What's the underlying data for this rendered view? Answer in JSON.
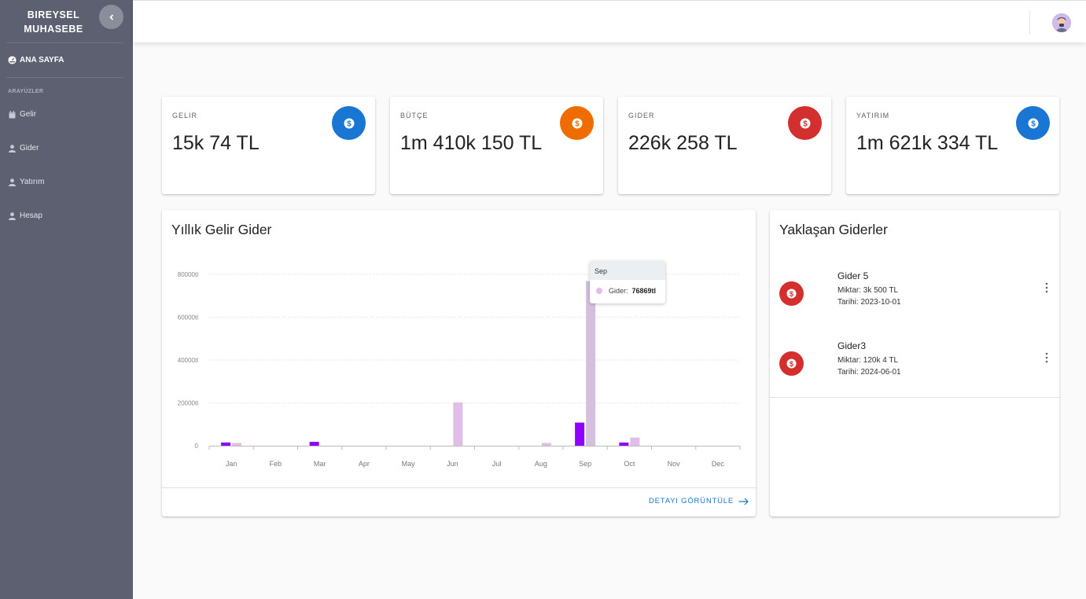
{
  "app": {
    "brand_line1": "BIREYSEL",
    "brand_line2": "MUHASEBE"
  },
  "sidebar": {
    "home_label": "ANA SAYFA",
    "section_title": "ARAYÜZLER",
    "items": [
      {
        "label": "Gelir",
        "icon": "calendar-icon"
      },
      {
        "label": "Gider",
        "icon": "person-icon"
      },
      {
        "label": "Yatırım",
        "icon": "person-icon"
      },
      {
        "label": "Hesap",
        "icon": "person-icon"
      }
    ]
  },
  "stats": [
    {
      "label": "GELIR",
      "value": "15k 74 TL",
      "color": "#1976d2",
      "icon": "dollar-icon"
    },
    {
      "label": "BÜTÇE",
      "value": "1m 410k 150 TL",
      "color": "#ef6c00",
      "icon": "dollar-icon"
    },
    {
      "label": "GIDER",
      "value": "226k 258 TL",
      "color": "#d32f2f",
      "icon": "dollar-icon"
    },
    {
      "label": "YATIRIM",
      "value": "1m 621k 334 TL",
      "color": "#1976d2",
      "icon": "dollar-icon"
    }
  ],
  "chart": {
    "title": "Yıllık Gelir Gider",
    "detail_label": "DETAYI GÖRÜNTÜLE",
    "tooltip": {
      "title": "Sep",
      "series": "Gider:",
      "value": "76869tl"
    }
  },
  "chart_data": {
    "type": "bar",
    "title": "Yıllık Gelir Gider",
    "categories": [
      "Jan",
      "Feb",
      "Mar",
      "Apr",
      "May",
      "Jun",
      "Jul",
      "Aug",
      "Sep",
      "Oct",
      "Nov",
      "Dec"
    ],
    "y_tick_labels": [
      "0",
      "20000tl",
      "40000tl",
      "60000tl",
      "80000tl"
    ],
    "ylim": [
      0,
      80000
    ],
    "grid": true,
    "series": [
      {
        "name": "Gelir",
        "color": "#8e00ff",
        "values": [
          1500,
          0,
          1800,
          0,
          0,
          0,
          0,
          0,
          10800,
          1500,
          0,
          0
        ]
      },
      {
        "name": "Gider",
        "color": "#e1bee7",
        "values": [
          1300,
          0,
          0,
          0,
          0,
          20200,
          0,
          1300,
          76869,
          3800,
          0,
          0
        ]
      }
    ]
  },
  "upcoming": {
    "title": "Yaklaşan Giderler",
    "items": [
      {
        "name": "Gider 5",
        "amount": "Miktar: 3k 500 TL",
        "date": "Tarihi: 2023-10-01"
      },
      {
        "name": "Gider3",
        "amount": "Miktar: 120k 4 TL",
        "date": "Tarihi: 2024-06-01"
      }
    ]
  }
}
